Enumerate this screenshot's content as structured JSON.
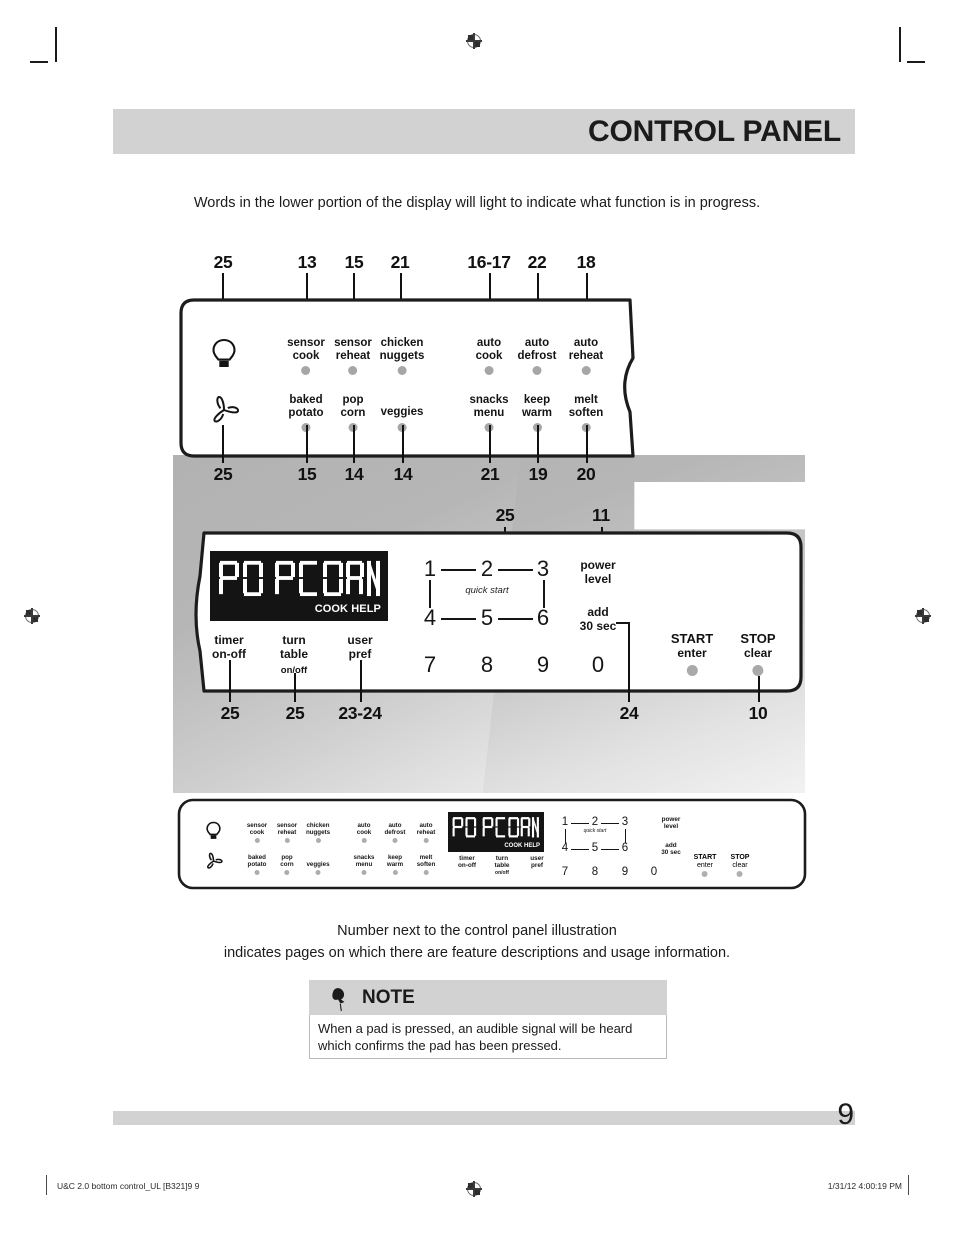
{
  "header": {
    "title": "CONTROL PANEL"
  },
  "intro": "Words in the lower portion of the display will light to indicate what function is in progress.",
  "colors": {
    "header_band": "#d2d2d2",
    "panel_outline": "#1c1c1c",
    "lcd_background": "#141414",
    "indicator_dot": "#a6a6a6",
    "shadow_gray": "#b3b3b3"
  },
  "top_panel": {
    "icons": [
      {
        "name": "light-bulb-icon",
        "label": "light"
      },
      {
        "name": "fan-icon",
        "label": "vent fan"
      }
    ],
    "row1_pads": [
      {
        "line1": "sensor",
        "line2": "cook"
      },
      {
        "line1": "sensor",
        "line2": "reheat"
      },
      {
        "line1": "chicken",
        "line2": "nuggets"
      },
      {
        "line1": "auto",
        "line2": "cook"
      },
      {
        "line1": "auto",
        "line2": "defrost"
      },
      {
        "line1": "auto",
        "line2": "reheat"
      }
    ],
    "row2_pads": [
      {
        "line1": "baked",
        "line2": "potato"
      },
      {
        "line1": "pop",
        "line2": "corn"
      },
      {
        "line1": "veggies",
        "line2": ""
      },
      {
        "line1": "snacks",
        "line2": "menu"
      },
      {
        "line1": "keep",
        "line2": "warm"
      },
      {
        "line1": "melt",
        "line2": "soften"
      }
    ],
    "callouts_above": [
      "25",
      "13",
      "15",
      "21",
      "16-17",
      "22",
      "18"
    ],
    "callouts_below": [
      "25",
      "15",
      "14",
      "14",
      "21",
      "19",
      "20"
    ]
  },
  "main_panel": {
    "callouts_above": [
      "25",
      "11"
    ],
    "callouts_below": [
      "25",
      "25",
      "23-24",
      "24",
      "10"
    ],
    "display": {
      "text": "POPCORN",
      "indicator": "COOK HELP"
    },
    "function_labels": [
      {
        "line1": "timer",
        "line2": "on-off",
        "sub": ""
      },
      {
        "line1": "turn",
        "line2": "table",
        "sub": "on/off"
      },
      {
        "line1": "user",
        "line2": "pref",
        "sub": ""
      }
    ],
    "keypad": [
      "1",
      "2",
      "3",
      "4",
      "5",
      "6",
      "7",
      "8",
      "9",
      "0"
    ],
    "quick_start": "quick start",
    "power_level": {
      "line1": "power",
      "line2": "level"
    },
    "add_30_sec": {
      "line1": "add",
      "line2": "30 sec"
    },
    "start_button": {
      "line1": "START",
      "line2": "enter"
    },
    "stop_button": {
      "line1": "STOP",
      "line2": "clear"
    }
  },
  "mini_panel": {
    "row1_pads": [
      {
        "line1": "sensor",
        "line2": "cook"
      },
      {
        "line1": "sensor",
        "line2": "reheat"
      },
      {
        "line1": "chicken",
        "line2": "nuggets"
      },
      {
        "line1": "auto",
        "line2": "cook"
      },
      {
        "line1": "auto",
        "line2": "defrost"
      },
      {
        "line1": "auto",
        "line2": "reheat"
      }
    ],
    "row2_pads": [
      {
        "line1": "baked",
        "line2": "potato"
      },
      {
        "line1": "pop",
        "line2": "corn"
      },
      {
        "line1": "veggies",
        "line2": ""
      },
      {
        "line1": "snacks",
        "line2": "menu"
      },
      {
        "line1": "keep",
        "line2": "warm"
      },
      {
        "line1": "melt",
        "line2": "soften"
      }
    ],
    "display": {
      "text": "POPCORN",
      "indicator": "COOK HELP"
    },
    "function_labels": [
      {
        "line1": "timer",
        "line2": "on-off",
        "sub": ""
      },
      {
        "line1": "turn",
        "line2": "table",
        "sub": "on/off"
      },
      {
        "line1": "user",
        "line2": "pref",
        "sub": ""
      }
    ],
    "keypad": [
      "1",
      "2",
      "3",
      "4",
      "5",
      "6",
      "7",
      "8",
      "9",
      "0"
    ],
    "quick_start": "quick start",
    "power_level": {
      "line1": "power",
      "line2": "level"
    },
    "add_30_sec": {
      "line1": "add",
      "line2": "30 sec"
    },
    "start_button": {
      "line1": "START",
      "line2": "enter"
    },
    "stop_button": {
      "line1": "STOP",
      "line2": "clear"
    }
  },
  "caption": {
    "line1": "Number next to the control panel illustration",
    "line2": "indicates pages on which there are feature descriptions and usage information."
  },
  "note": {
    "title": "NOTE",
    "icon": "push-pin-icon",
    "body": "When a pad is pressed, an audible signal will be heard which confirms the pad has been pressed."
  },
  "footer": {
    "page_number": "9",
    "left": "U&C 2.0 bottom control_UL [B321]9   9",
    "right": "1/31/12   4:00:19 PM"
  }
}
